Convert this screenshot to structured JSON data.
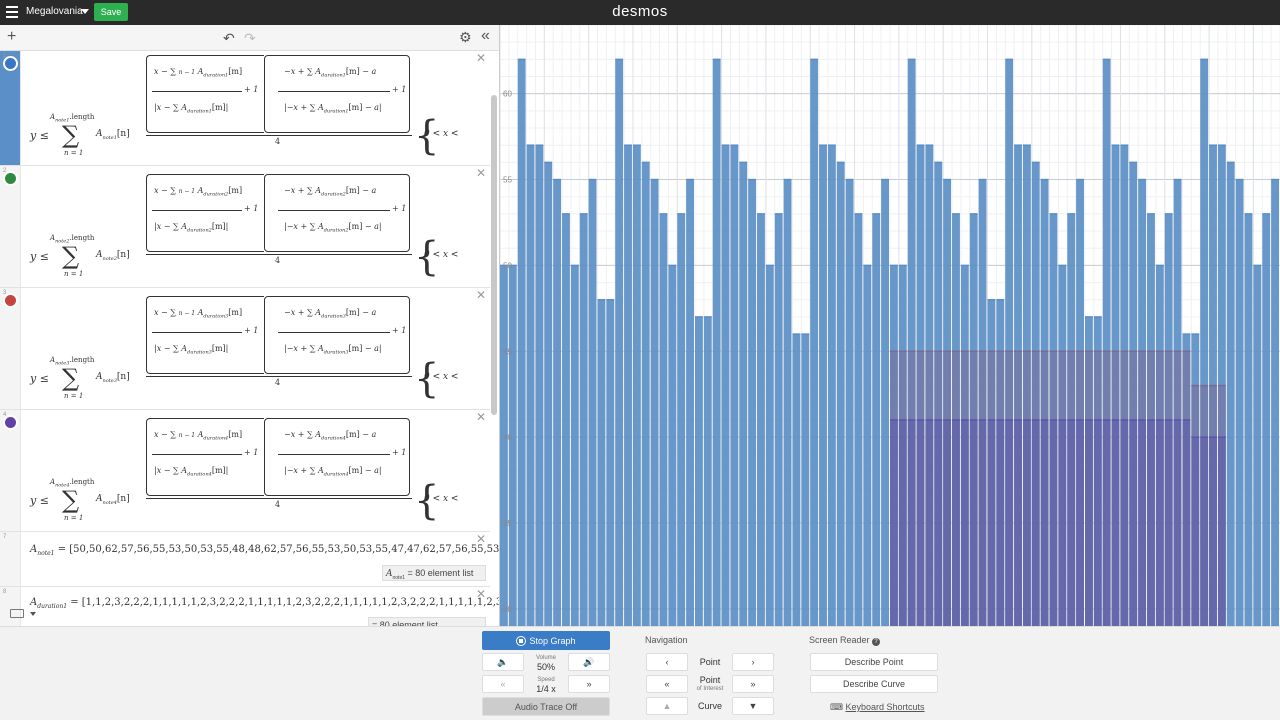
{
  "app": {
    "title": "Megalovania",
    "save_label": "Save",
    "logo": "desmos"
  },
  "toolbar": {
    "add_icon": "plus-icon",
    "undo_icon": "undo-icon",
    "redo_icon": "redo-icon",
    "settings_icon": "gear-icon",
    "collapse_icon": "double-chevron-left-icon"
  },
  "expressions": [
    {
      "id": "1",
      "color": "#3a76c4",
      "lhs": "y ≤",
      "upper": "A",
      "upper_sub": "note1",
      "upper_suffix": ".length",
      "lower": "n = 1",
      "term": "A",
      "term_sub": "note1",
      "term_index": "[n]",
      "dur_sub": "duration1",
      "denom": "4",
      "domain": "0 < x <"
    },
    {
      "id": "2",
      "color": "#2d8a3e",
      "lhs": "y ≤",
      "upper": "A",
      "upper_sub": "note2",
      "upper_suffix": ".length",
      "lower": "n = 1",
      "term": "A",
      "term_sub": "note2",
      "term_index": "[n]",
      "dur_sub": "duration2",
      "denom": "4",
      "domain": "0 < x <"
    },
    {
      "id": "3",
      "color": "#c74440",
      "lhs": "y ≤",
      "upper": "A",
      "upper_sub": "note3",
      "upper_suffix": ".length",
      "lower": "n = 1",
      "term": "A",
      "term_sub": "note3",
      "term_index": "[n]",
      "dur_sub": "duration3",
      "denom": "4",
      "domain": "0 < x <"
    },
    {
      "id": "4",
      "color": "#6042a6",
      "lhs": "y ≤",
      "upper": "A",
      "upper_sub": "note4",
      "upper_suffix": ".length",
      "lower": "n = 1",
      "term": "A",
      "term_sub": "note4",
      "term_index": "[n]",
      "dur_sub": "duration4",
      "denom": "4",
      "domain": "0 < x <"
    }
  ],
  "fraction_parts": {
    "x_minus": "x −",
    "minus_x_plus": "−x +",
    "sum_upper_n1": "n − 1",
    "sum_upper_n": "n",
    "sum_lower": "m = 1",
    "a_m": "[m]",
    "minus_a": "− a",
    "plus_one": "+ 1"
  },
  "list_expr_1": {
    "id": "7",
    "name": "A",
    "sub": "note1",
    "values": "= [50,50,62,57,56,55,53,50,53,55,48,48,62,57,56,55,53,50,53,55,47,47,62,57,56,55,53",
    "summary_name": "A",
    "summary_sub": "note1",
    "summary": "= 80 element list"
  },
  "list_expr_2": {
    "id": "8",
    "name": "A",
    "sub": "duration1",
    "values": "= [1,1,2,3,2,2,2,1,1,1,1,1,2,3,2,2,2,1,1,1,1,1,2,3,2,2,2,1,1,1,1,1,2,3,2,2,2,1,1,1,1,1,2,3",
    "summary": "= 80 element list"
  },
  "keyboard_icon": "keyboard-icon",
  "graph": {
    "tick_labels": [
      "60",
      "55",
      "50",
      "45",
      "40",
      "35",
      "30"
    ]
  },
  "chart_data": {
    "type": "bar",
    "series": [
      {
        "color": "#5b8ec4",
        "values": [
          50,
          50,
          62,
          57,
          57,
          56,
          55,
          53,
          50,
          53,
          55,
          48,
          48,
          62,
          57,
          57,
          56,
          55,
          53,
          50,
          53,
          55,
          47,
          47,
          62,
          57,
          57,
          56,
          55,
          53,
          50,
          53,
          55,
          46,
          46,
          62,
          57,
          57,
          56,
          55,
          53,
          50,
          53,
          55,
          50,
          50,
          62,
          57,
          57,
          56,
          55,
          53,
          50,
          53,
          55,
          48,
          48,
          62,
          57,
          57,
          56,
          55,
          53,
          50,
          53,
          55,
          47,
          47,
          62,
          57,
          57,
          56,
          55,
          53,
          50,
          53,
          55,
          46,
          46,
          62,
          57,
          57,
          56,
          55,
          53,
          50,
          53,
          55
        ]
      },
      {
        "color": "#7a6a96",
        "values": [
          45,
          45,
          45,
          45,
          45,
          45,
          45,
          45,
          45,
          45,
          45,
          45,
          45,
          45,
          45,
          45,
          45,
          45,
          45,
          45,
          45,
          45,
          45,
          45,
          45,
          45,
          45,
          45,
          45,
          45,
          45,
          45,
          45,
          45,
          43,
          43,
          43,
          43
        ]
      },
      {
        "color": "#5b55a8",
        "values": [
          41,
          41,
          41,
          41,
          41,
          41,
          41,
          41,
          41,
          41,
          41,
          41,
          41,
          41,
          41,
          41,
          41,
          41,
          41,
          41,
          41,
          41,
          41,
          41,
          41,
          41,
          41,
          41,
          41,
          41,
          41,
          41,
          41,
          41,
          40,
          40,
          40,
          40
        ]
      }
    ],
    "xlim": [
      0,
      88
    ],
    "ylim": [
      29,
      64
    ],
    "grid": true
  },
  "audio": {
    "stop_graph": "Stop Graph",
    "volume_label": "Volume",
    "volume_value": "50%",
    "speed_label": "Speed",
    "speed_value": "1/4 x",
    "audio_trace": "Audio Trace Off",
    "navigation": "Navigation",
    "point": "Point",
    "point_of_interest": "Point",
    "point_of_interest_sub": "of Interest",
    "curve": "Curve",
    "screen_reader": "Screen Reader",
    "describe_point": "Describe Point",
    "describe_curve": "Describe Curve",
    "keyboard_shortcuts": "Keyboard Shortcuts"
  }
}
